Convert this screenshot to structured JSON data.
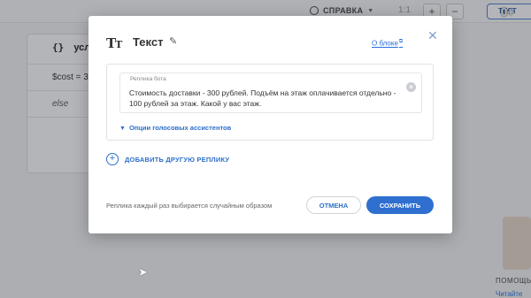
{
  "background": {
    "help_menu": {
      "label": "СПРАВКА",
      "icon": "globe-icon"
    },
    "block": {
      "icon": "{}",
      "title": "усло",
      "rows": [
        "$cost = 3",
        "else"
      ]
    },
    "badge": "0+",
    "test_button": "ТЕСТ",
    "help_side_text": "ПОМОЩЬ",
    "help_side_link": "Читайте"
  },
  "modal": {
    "title_icon": "TT",
    "title": "Текст",
    "about_link": "О блоке",
    "reply": {
      "label": "Реплика бота",
      "text": "Стоимость доставки - 300 рублей. Подъём на этаж оплачивается отдельно - 100 рублей за этаж. Какой у вас этаж."
    },
    "voice_assistants_toggle": "Опции голосовых ассистентов",
    "add_reply": "ДОБАВИТЬ ДРУГУЮ РЕПЛИКУ",
    "footer_note": "Реплика каждый раз выбирается случайным образом",
    "buttons": {
      "cancel": "ОТМЕНА",
      "save": "СОХРАНИТЬ"
    }
  },
  "colors": {
    "accent": "#2f6fd0",
    "link": "#2a6fdb"
  }
}
